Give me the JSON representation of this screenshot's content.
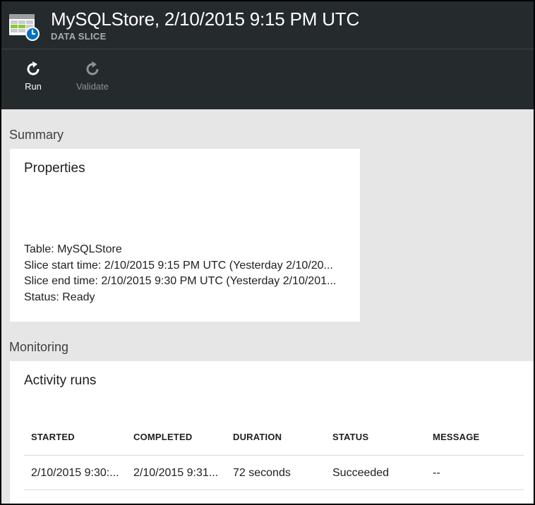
{
  "header": {
    "title": "MySQLStore, 2/10/2015 9:15 PM UTC",
    "subtitle": "DATA SLICE",
    "icon": "data-slice-table-clock-icon"
  },
  "toolbar": {
    "run_label": "Run",
    "run_icon": "refresh-icon",
    "validate_label": "Validate",
    "validate_icon": "refresh-icon"
  },
  "summary": {
    "section_label": "Summary",
    "card_title": "Properties",
    "lines": [
      "Table: MySQLStore",
      "Slice start time: 2/10/2015 9:15 PM UTC (Yesterday 2/10/20...",
      "Slice end time: 2/10/2015 9:30 PM UTC (Yesterday 2/10/201...",
      "Status: Ready"
    ]
  },
  "monitoring": {
    "section_label": "Monitoring",
    "card_title": "Activity runs",
    "columns": [
      "STARTED",
      "COMPLETED",
      "DURATION",
      "STATUS",
      "MESSAGE"
    ],
    "rows": [
      [
        "2/10/2015 9:30:...",
        "2/10/2015 9:31...",
        "72 seconds",
        "Succeeded",
        "--"
      ]
    ]
  },
  "colors": {
    "header_bg": "#252a2c",
    "content_bg": "#e6e6e6",
    "card_bg": "#ffffff",
    "icon_green": "#8cc63f",
    "icon_blue": "#0072c6"
  }
}
